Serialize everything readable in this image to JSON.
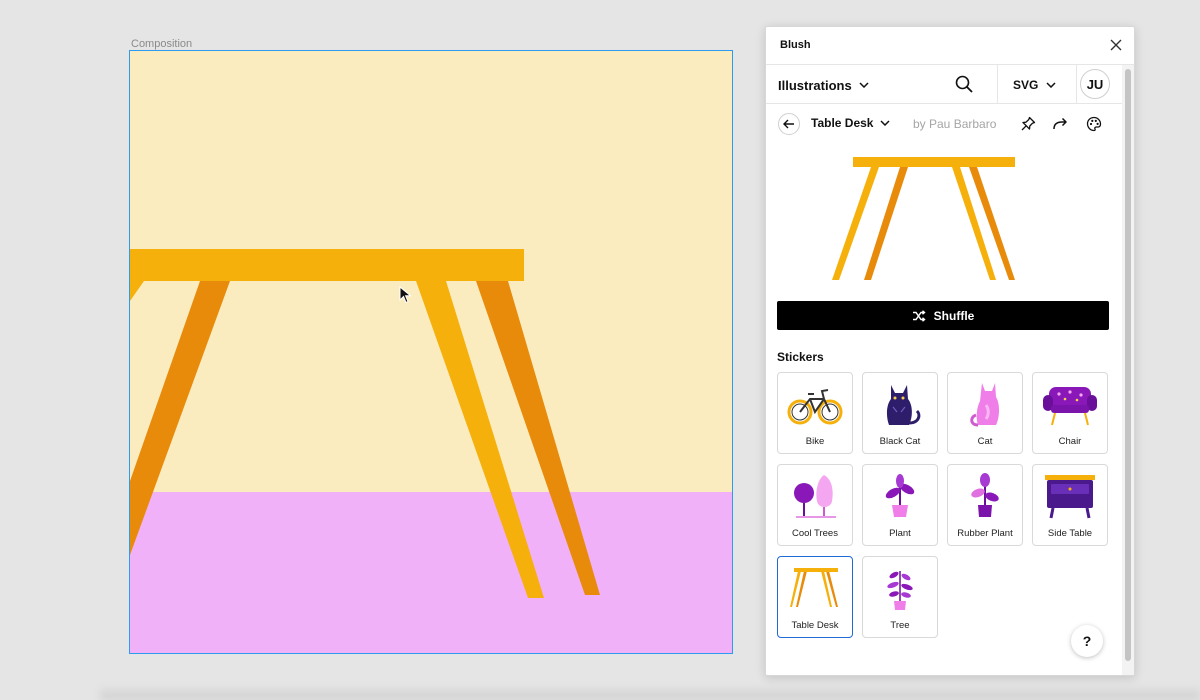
{
  "canvas": {
    "frame_label": "Composition"
  },
  "colors": {
    "sky": "#fbecbf",
    "floor": "#f1b1f9",
    "table_top": "#f6b00c",
    "leg_dark": "#e88b0b",
    "selection": "#2d9bf0",
    "accent_purple": "#7a1fc2"
  },
  "panel": {
    "title": "Blush",
    "close_icon": "close-icon",
    "toolbar": {
      "category": "Illustrations",
      "format": "SVG",
      "avatar_initials": "JU"
    },
    "detail": {
      "illustration_name": "Table Desk",
      "author": "by Pau Barbaro"
    },
    "shuffle_label": "Shuffle",
    "stickers_heading": "Stickers",
    "stickers": [
      {
        "label": "Bike",
        "icon": "bike-icon"
      },
      {
        "label": "Black Cat",
        "icon": "black-cat-icon"
      },
      {
        "label": "Cat",
        "icon": "cat-icon"
      },
      {
        "label": "Chair",
        "icon": "chair-icon"
      },
      {
        "label": "Cool Trees",
        "icon": "cool-trees-icon"
      },
      {
        "label": "Plant",
        "icon": "plant-icon"
      },
      {
        "label": "Rubber Plant",
        "icon": "rubber-plant-icon"
      },
      {
        "label": "Side Table",
        "icon": "side-table-icon"
      },
      {
        "label": "Table Desk",
        "icon": "table-desk-icon",
        "selected": true
      },
      {
        "label": "Tree",
        "icon": "tree-icon"
      }
    ],
    "help_label": "?"
  }
}
